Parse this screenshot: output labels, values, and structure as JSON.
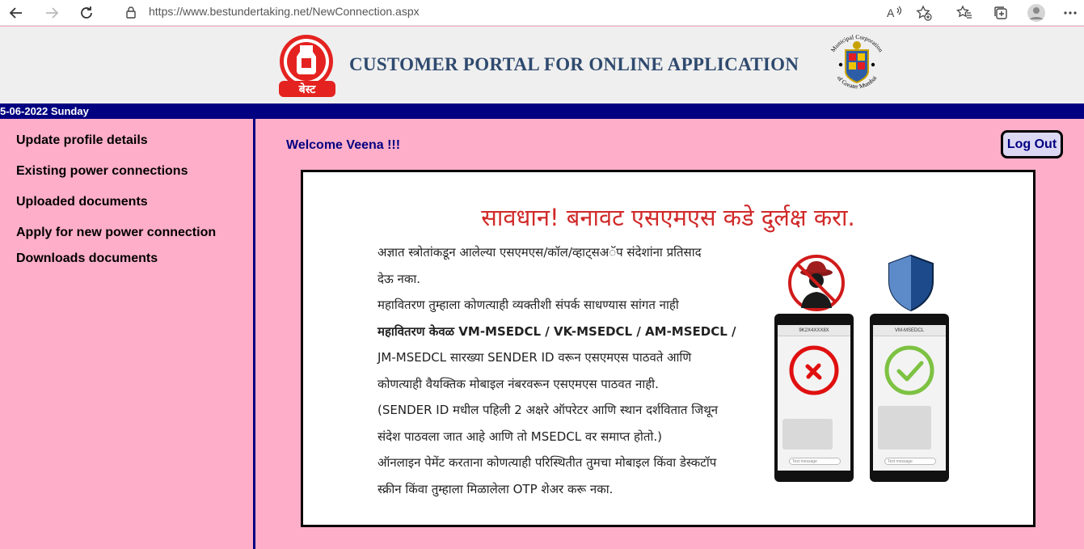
{
  "browser": {
    "url": "https://www.bestundertaking.net/NewConnection.aspx"
  },
  "header": {
    "logo_text": "बेस्ट",
    "title": "CUSTOMER PORTAL FOR ONLINE APPLICATION",
    "seal_text_top": "Municipal Corporation",
    "seal_text_bottom": "of Greater Mumbai"
  },
  "datebar": {
    "text": "5-06-2022 Sunday"
  },
  "sidebar": {
    "items": [
      {
        "label": "Update profile details"
      },
      {
        "label": "Existing power connections"
      },
      {
        "label": "Uploaded documents"
      },
      {
        "label": "Apply for new power connection"
      },
      {
        "label": "Downloads documents"
      }
    ]
  },
  "main": {
    "welcome": "Welcome Veena !!!",
    "logout_label": "Log Out"
  },
  "notice": {
    "title": "सावधान! बनावट एसएमएस कडे दुर्लक्ष करा.",
    "lines": [
      "अज्ञात स्त्रोतांकडून आलेल्या एसएमएस/कॉल/व्हाट्सअॅप संदेशांना प्रतिसाद",
      "देऊ नका.",
      "महावितरण तुम्हाला कोणत्याही व्यक्तीशी संपर्क साधण्यास सांगत नाही",
      "महावितरण केवळ VM-MSEDCL / VK-MSEDCL / AM-MSEDCL /",
      "JM-MSEDCL सारख्या SENDER ID वरून एसएमएस पाठवते आणि",
      "कोणत्याही वैयक्तिक मोबाइल नंबरवरून एसएमएस पाठवत नाही.",
      "(SENDER ID मधील पहिली 2 अक्षरे ऑपरेटर आणि स्थान दर्शवितात जिथून",
      "संदेश पाठवला जात आहे आणि तो MSEDCL वर समाप्त होतो.)",
      "ऑनलाइन पेमेंट करताना कोणत्याही परिस्थितीत तुमचा मोबाइल किंवा डेस्कटॉप",
      "स्क्रीन किंवा तुम्हाला मिळालेला OTP शेअर करू नका."
    ],
    "phone_fake_sender": "9K2X4XXX8X",
    "phone_real_sender": "VM-MSEDCL",
    "phone_input_placeholder": "Text message",
    "colors": {
      "fake": "#e01010",
      "genuine": "#7dc242",
      "shield": "#1d4a8a"
    }
  }
}
